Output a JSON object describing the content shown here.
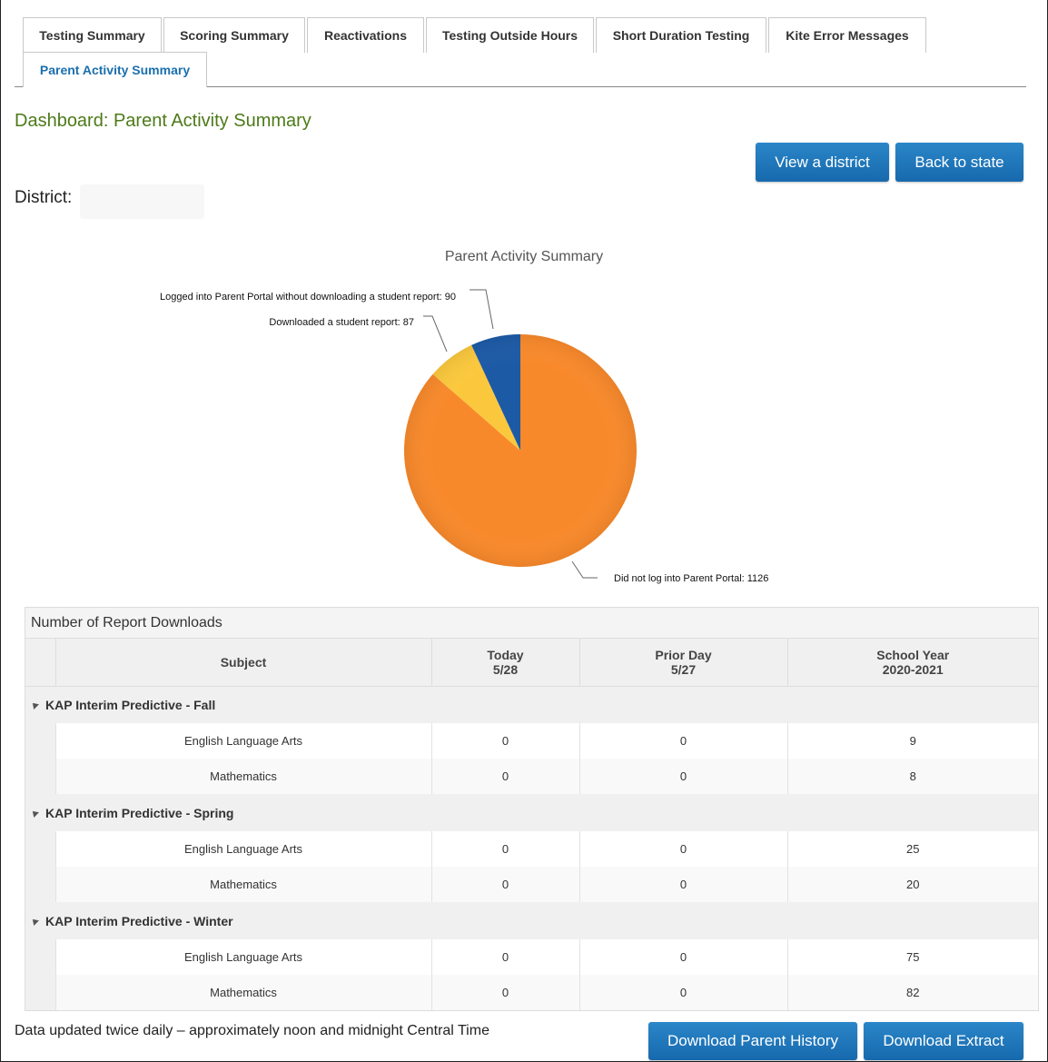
{
  "tabs": [
    {
      "label": "Testing Summary"
    },
    {
      "label": "Scoring Summary"
    },
    {
      "label": "Reactivations"
    },
    {
      "label": "Testing Outside Hours"
    },
    {
      "label": "Short Duration Testing"
    },
    {
      "label": "Kite Error Messages"
    },
    {
      "label": "Parent Activity Summary",
      "active": true
    }
  ],
  "page": {
    "title": "Dashboard: Parent Activity Summary",
    "district_label": "District:",
    "district_value": ""
  },
  "buttons": {
    "view_district": "View a district",
    "back_to_state": "Back to state",
    "download_history": "Download Parent History",
    "download_extract": "Download Extract"
  },
  "chart_data": {
    "type": "pie",
    "title": "Parent Activity Summary",
    "slices": [
      {
        "label": "Did not log into Parent Portal",
        "value": 1126,
        "color": "#f8892b"
      },
      {
        "label": "Downloaded a student report",
        "value": 87,
        "color": "#fbc83d"
      },
      {
        "label": "Logged into Parent Portal without downloading a student report",
        "value": 90,
        "color": "#1d5aa6"
      }
    ],
    "data_labels": [
      "Did not log into Parent Portal: 1126",
      "Downloaded a student report: 87",
      "Logged into Parent Portal without downloading a student report: 90"
    ]
  },
  "table": {
    "caption": "Number of Report Downloads",
    "headers": {
      "subject": "Subject",
      "today": "Today",
      "today_date": "5/28",
      "prior": "Prior Day",
      "prior_date": "5/27",
      "year": "School Year",
      "year_range": "2020-2021"
    },
    "groups": [
      {
        "name": "KAP Interim Predictive - Fall",
        "rows": [
          {
            "subject": "English Language Arts",
            "today": "0",
            "prior": "0",
            "year": "9"
          },
          {
            "subject": "Mathematics",
            "today": "0",
            "prior": "0",
            "year": "8"
          }
        ]
      },
      {
        "name": "KAP Interim Predictive - Spring",
        "rows": [
          {
            "subject": "English Language Arts",
            "today": "0",
            "prior": "0",
            "year": "25"
          },
          {
            "subject": "Mathematics",
            "today": "0",
            "prior": "0",
            "year": "20"
          }
        ]
      },
      {
        "name": "KAP Interim Predictive - Winter",
        "rows": [
          {
            "subject": "English Language Arts",
            "today": "0",
            "prior": "0",
            "year": "75"
          },
          {
            "subject": "Mathematics",
            "today": "0",
            "prior": "0",
            "year": "82"
          }
        ]
      }
    ]
  },
  "footer": {
    "note": "Data updated twice daily – approximately noon and midnight Central Time"
  }
}
